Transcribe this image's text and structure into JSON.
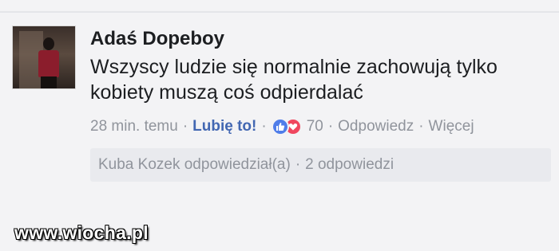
{
  "comment": {
    "author": "Adaś Dopeboy",
    "text": "Wszyscy ludzie się normalnie zachowują tylko\nkobiety muszą coś odpierdalać",
    "time": "28 min. temu",
    "like_label": "Lubię to!",
    "reactions": [
      "like-icon",
      "love-icon"
    ],
    "reaction_count": "70",
    "reply_label": "Odpowiedz",
    "more_label": "Więcej",
    "separator": "·"
  },
  "replies": {
    "preview": "Kuba Kozek odpowiedział(a)",
    "count": "2 odpowiedzi"
  },
  "watermark": "www.wiocha.pl",
  "colors": {
    "link": "#4267b2",
    "like": "#4f7de9",
    "love": "#f0475f",
    "meta": "#90949c",
    "text": "#1c1e21"
  }
}
